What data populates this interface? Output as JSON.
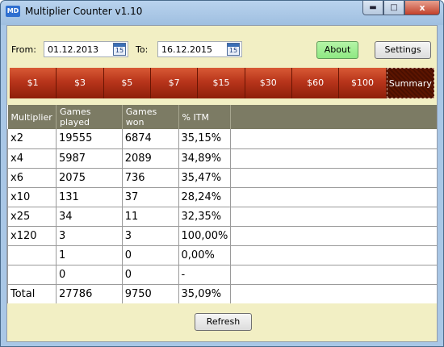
{
  "window": {
    "app_badge": "MD",
    "title": "Multiplier Counter v1.10",
    "close_glyph": "x"
  },
  "filters": {
    "from_label": "From:",
    "from_value": "01.12.2013",
    "to_label": "To:",
    "to_value": "16.12.2015",
    "calendar_day": "15"
  },
  "buttons": {
    "about": "About",
    "settings": "Settings",
    "refresh": "Refresh"
  },
  "tabs": [
    "$1",
    "$3",
    "$5",
    "$7",
    "$15",
    "$30",
    "$60",
    "$100",
    "Summary"
  ],
  "active_tab": "Summary",
  "table": {
    "columns": [
      "Multiplier",
      "Games played",
      "Games won",
      "% ITM"
    ],
    "rows": [
      [
        "x2",
        "19555",
        "6874",
        "35,15%"
      ],
      [
        "x4",
        "5987",
        "2089",
        "34,89%"
      ],
      [
        "x6",
        "2075",
        "736",
        "35,47%"
      ],
      [
        "x10",
        "131",
        "37",
        "28,24%"
      ],
      [
        "x25",
        "34",
        "11",
        "32,35%"
      ],
      [
        "x120",
        "3",
        "3",
        "100,00%"
      ],
      [
        "",
        "1",
        "0",
        "0,00%"
      ],
      [
        "",
        "0",
        "0",
        "-"
      ],
      [
        "Total",
        "27786",
        "9750",
        "35,09%"
      ]
    ]
  },
  "colors": {
    "tab_bar": "#b8351b",
    "header": "#7c7b64",
    "panel": "#f2efc4",
    "about_button": "#9aee8c"
  }
}
